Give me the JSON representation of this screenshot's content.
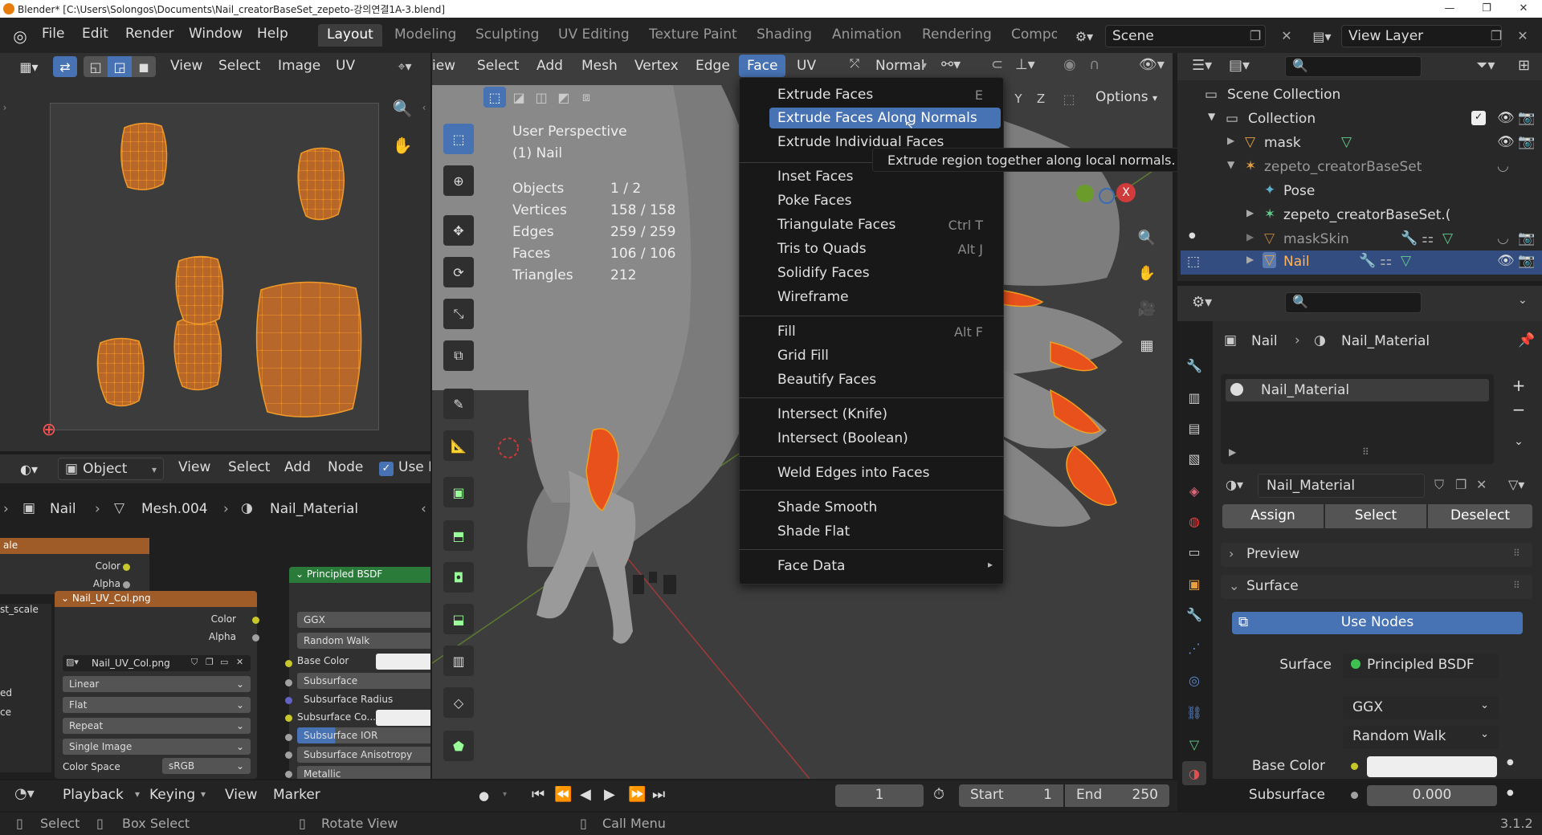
{
  "window": {
    "title": "Blender* [C:\\Users\\Solongos\\Documents\\Nail_creatorBaseSet_zepeto-강의연결1A-3.blend]"
  },
  "topbar": {
    "menus": [
      "File",
      "Edit",
      "Render",
      "Window",
      "Help"
    ],
    "workspaces": [
      "Layout",
      "Modeling",
      "Sculpting",
      "UV Editing",
      "Texture Paint",
      "Shading",
      "Animation",
      "Rendering",
      "Compo"
    ],
    "scene": "Scene",
    "view_layer": "View Layer"
  },
  "uv_editor": {
    "menus": [
      "View",
      "Select",
      "Image",
      "UV"
    ]
  },
  "viewport": {
    "menus": [
      "iew",
      "Select",
      "Add",
      "Mesh",
      "Vertex",
      "Edge",
      "Face",
      "UV"
    ],
    "orientation": "Normal",
    "options": "Options",
    "axes": [
      "Y",
      "Z"
    ],
    "overlay": {
      "title": "User Perspective",
      "object": "(1) Nail",
      "stats": [
        {
          "label": "Objects",
          "value": "1 / 2"
        },
        {
          "label": "Vertices",
          "value": "158 / 158"
        },
        {
          "label": "Edges",
          "value": "259 / 259"
        },
        {
          "label": "Faces",
          "value": "106 / 106"
        },
        {
          "label": "Triangles",
          "value": "212"
        }
      ]
    }
  },
  "face_menu": {
    "items": [
      {
        "label": "Extrude Faces",
        "shortcut": "E"
      },
      {
        "label": "Extrude Faces Along Normals",
        "shortcut": ""
      },
      {
        "label": "Extrude Individual Faces",
        "shortcut": ""
      },
      {
        "label": "Inset Faces",
        "shortcut": ""
      },
      {
        "label": "Poke Faces",
        "shortcut": ""
      },
      {
        "label": "Triangulate Faces",
        "shortcut": "Ctrl T"
      },
      {
        "label": "Tris to Quads",
        "shortcut": "Alt J"
      },
      {
        "label": "Solidify Faces",
        "shortcut": ""
      },
      {
        "label": "Wireframe",
        "shortcut": ""
      },
      {
        "label": "Fill",
        "shortcut": "Alt F"
      },
      {
        "label": "Grid Fill",
        "shortcut": ""
      },
      {
        "label": "Beautify Faces",
        "shortcut": ""
      },
      {
        "label": "Intersect (Knife)",
        "shortcut": ""
      },
      {
        "label": "Intersect (Boolean)",
        "shortcut": ""
      },
      {
        "label": "Weld Edges into Faces",
        "shortcut": ""
      },
      {
        "label": "Shade Smooth",
        "shortcut": ""
      },
      {
        "label": "Shade Flat",
        "shortcut": ""
      },
      {
        "label": "Face Data",
        "shortcut": "▸"
      }
    ],
    "tooltip": "Extrude region together along local normals."
  },
  "node_editor": {
    "mode": "Object",
    "menus": [
      "View",
      "Select",
      "Add",
      "Node"
    ],
    "use_nodes_label": "Use N",
    "breadcrumb": [
      "Nail",
      "Mesh.004",
      "Nail_Material"
    ],
    "node_left": {
      "title": "ale",
      "rows": [
        "Color",
        "Alpha"
      ]
    },
    "image_node": {
      "title": "Nail_UV_Col.png",
      "rows": [
        "Color",
        "Alpha"
      ],
      "image": "Nail_UV_Col.png",
      "interpolation": "Linear",
      "projection": "Flat",
      "extension": "Repeat",
      "source": "Single Image",
      "color_space_label": "Color Space",
      "color_space": "sRGB"
    },
    "left_labels": [
      "st_scale",
      "ed",
      "ce"
    ],
    "bsdf": {
      "title": "Principled BSDF",
      "dist": "GGX",
      "sss": "Random Walk",
      "rows": [
        "Base Color",
        "Subsurface",
        "Subsurface Radius",
        "Subsurface Co...",
        "Subsurface IOR",
        "Subsurface Anisotropy",
        "Metallic"
      ]
    }
  },
  "outliner": {
    "items": [
      {
        "name": "Scene Collection",
        "indent": 0
      },
      {
        "name": "Collection",
        "indent": 1
      },
      {
        "name": "mask",
        "indent": 2
      },
      {
        "name": "zepeto_creatorBaseSet",
        "indent": 2
      },
      {
        "name": "Pose",
        "indent": 3
      },
      {
        "name": "zepeto_creatorBaseSet.(",
        "indent": 3
      },
      {
        "name": "maskSkin",
        "indent": 2
      },
      {
        "name": "Nail",
        "indent": 2
      }
    ]
  },
  "properties": {
    "breadcrumb": [
      "Nail",
      "Nail_Material"
    ],
    "slot": "Nail_Material",
    "material_name": "Nail_Material",
    "buttons": [
      "Assign",
      "Select",
      "Deselect"
    ],
    "panels": [
      "Preview",
      "Surface"
    ],
    "use_nodes": "Use Nodes",
    "surface_label": "Surface",
    "surface_value": "Principled BSDF",
    "dist": "GGX",
    "sss": "Random Walk",
    "base_color_label": "Base Color",
    "subsurface_label": "Subsurface",
    "subsurface_value": "0.000"
  },
  "timeline": {
    "menus": [
      "Playback",
      "Keying",
      "View",
      "Marker"
    ],
    "current_frame": "1",
    "start_label": "Start",
    "start": "1",
    "end_label": "End",
    "end": "250"
  },
  "statusbar": {
    "items": [
      "Select",
      "Box Select",
      "Rotate View",
      "Call Menu"
    ],
    "version": "3.1.2"
  },
  "colors": {
    "accent": "#4772b3",
    "orange": "#e87d0d",
    "uv_mesh": "#c8702c"
  }
}
